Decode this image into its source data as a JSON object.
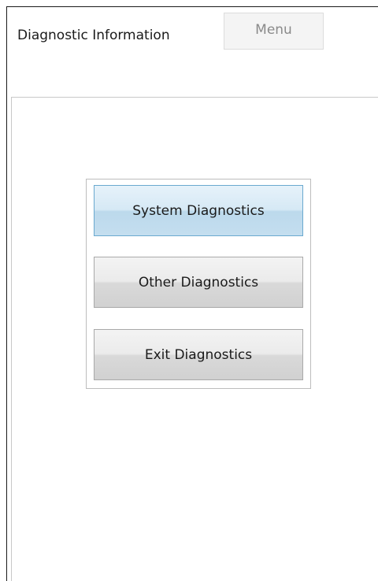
{
  "header": {
    "title": "Diagnostic Information",
    "menu_label": "Menu"
  },
  "dialog": {
    "buttons": [
      {
        "label": "System Diagnostics",
        "state": "selected"
      },
      {
        "label": "Other Diagnostics",
        "state": "normal"
      },
      {
        "label": "Exit Diagnostics",
        "state": "normal"
      }
    ]
  },
  "colors": {
    "selected_border": "#6aa9cf",
    "selected_fill": "#d6e9f5",
    "normal_border": "#a9a9a9",
    "normal_fill": "#e3e3e3",
    "menu_text": "#8a8a8a"
  }
}
